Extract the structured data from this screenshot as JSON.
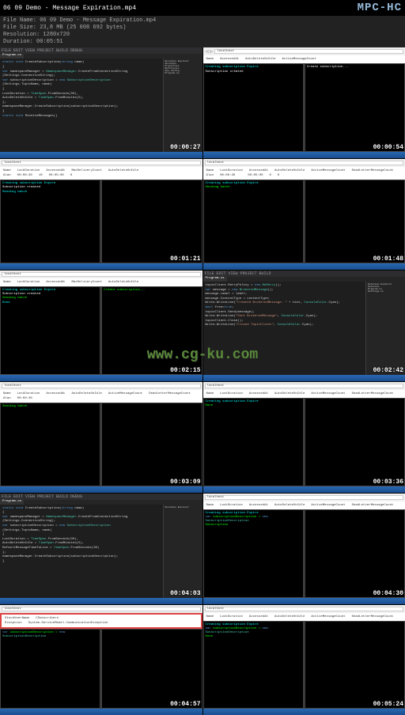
{
  "player": {
    "title": "06 09 Demo - Message Expiration.mp4",
    "logo": "MPC-HC"
  },
  "meta": {
    "filename_label": "File Name:",
    "filename": "06 09 Demo - Message Expiration.mp4",
    "filesize_label": "File Size:",
    "filesize": "23,8 MB (25 008 692 bytes)",
    "resolution_label": "Resolution:",
    "resolution": "1280x720",
    "duration_label": "Duration:",
    "duration": "00:05:51"
  },
  "watermark": "www.cg-ku.com",
  "timestamps": [
    "00:00:27",
    "00:00:54",
    "00:01:21",
    "00:01:48",
    "00:02:15",
    "00:02:42",
    "00:03:09",
    "00:03:36",
    "00:04:03",
    "00:04:30",
    "00:04:57",
    "00:05:24"
  ],
  "code": {
    "line1_kw": "static void",
    "line1_name": " CreateSubscription(",
    "line1_kw2": "string",
    "line1_rest": " name)",
    "line2": "{",
    "line3_kw": "    var",
    "line3_rest": " namespaceManager = ",
    "line3_cls": "NamespaceManager",
    "line3_end": ".CreateFromConnectionString",
    "line4": "        (Settings.ConnectionString);",
    "line5_kw": "    var",
    "line5_rest": " subscriptionDescription = ",
    "line5_kw2": "new ",
    "line5_cls": "SubscriptionDescription",
    "line6": "        (Settings.TopicName, name)",
    "line7": "    {",
    "line8": "        LockDuration = ",
    "line8_cls": "TimeSpan",
    "line8_end": ".FromSeconds(30),",
    "line9": "        AutoDeleteOnIdle = ",
    "line9_cls": "TimeSpan",
    "line9_end": ".FromMinutes(5),",
    "line10": "        DefaultMessageTimeToLive = ",
    "line10_cls": "TimeSpan",
    "line10_end": ".FromSeconds(30)",
    "line11": "    };",
    "line12": "    namespaceManager.CreateSubscription(subscriptionDescription);",
    "line13": "}",
    "recv_kw": "static void",
    "recv_name": " ReceiveMessages()",
    "topic1": "    topicClient.RetryPolicy = ",
    "topic1_kw": "new ",
    "topic1_cls": "NoRetry",
    "topic1_end": "();",
    "topic2_kw": "    var",
    "topic2_rest": " message = ",
    "topic2_kw2": "new ",
    "topic2_cls": "BrokeredMessage",
    "topic2_end": "();",
    "topic3": "    message.Label = label;",
    "topic4": "    message.ContentType = contentType;",
    "topic5": "    Write.WriteLine(",
    "topic5_str": "\"Created BrokeredMessage: \"",
    "topic5_end": " + text, ",
    "topic5_cls": "ConsoleColor",
    "topic5_end2": ".Cyan);",
    "topic6_kw": "    bool",
    "topic6_rest": " free=",
    "topic6_kw2": "true",
    "topic6_end": ";",
    "topic7": "    topicClient.Send(message);",
    "topic8": "    topicClient.Close();",
    "topic9": "    Write.WriteLine(",
    "topic9_str": "\"Sent BrokeredMessage\"",
    "topic9_end": ", ",
    "topic9_cls": "ConsoleColor",
    "topic9_end2": ".Cyan);",
    "topic10": "    Write.WriteLine(",
    "topic10_str": "\"Closed TopicClient\"",
    "topic10_end": ", ",
    "topic10_cls": "ConsoleColor",
    "topic10_end2": ".Cyan);"
  },
  "browser": {
    "url": "localhost",
    "cols": [
      "Name",
      "LockDuration",
      "AccessedAt",
      "MaxDeliveryCount",
      "AutoDeleteOnIdle",
      "ActiveMessageCount",
      "DeadLetterMessageCount"
    ],
    "row1": [
      "Alan",
      "00:00:30",
      "",
      "10",
      "00:05:00",
      "0",
      "0"
    ],
    "row2_name": "StockUserName",
    "row2_val": "CSubscribers",
    "row3_name": "Exception",
    "row3_val": "System.ServiceModel.CommunicationException"
  },
  "console": {
    "l1": "Creating subscription Expire",
    "l2": "Subscription created",
    "l3": "Create subscription...",
    "l4": "Sending batch",
    "l5": "",
    "l6_cls": "var",
    "l6": " subscriptionDescription = ",
    "l6_kw": "new ",
    "l6_cls2": "SubscriptionDescription",
    "l7": " Subscription",
    "l8": "Done"
  },
  "solution": {
    "h": "Solution Explorer",
    "items": [
      "Solution",
      "Properties",
      "References",
      "App.config",
      "Program.cs",
      "Settings.cs"
    ]
  }
}
